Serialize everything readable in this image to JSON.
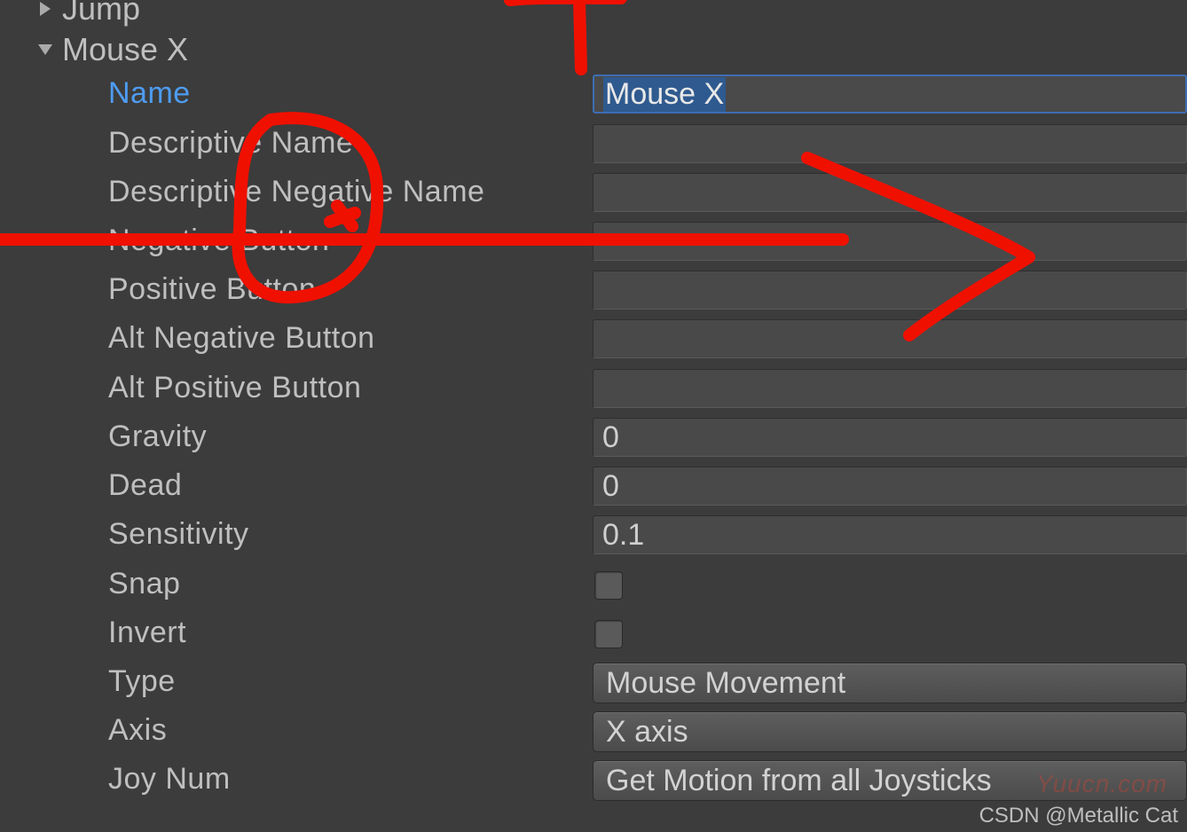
{
  "tree": {
    "jump_label": "Jump",
    "mousex_label": "Mouse X"
  },
  "labels": {
    "name": "Name",
    "descriptive_name": "Descriptive Name",
    "descriptive_negative_name": "Descriptive Negative Name",
    "negative_button": "Negative Button",
    "positive_button": "Positive Button",
    "alt_negative_button": "Alt Negative Button",
    "alt_positive_button": "Alt Positive Button",
    "gravity": "Gravity",
    "dead": "Dead",
    "sensitivity": "Sensitivity",
    "snap": "Snap",
    "invert": "Invert",
    "type": "Type",
    "axis": "Axis",
    "joy_num": "Joy Num"
  },
  "values": {
    "name": "Mouse X",
    "descriptive_name": "",
    "descriptive_negative_name": "",
    "negative_button": "",
    "positive_button": "",
    "alt_negative_button": "",
    "alt_positive_button": "",
    "gravity": "0",
    "dead": "0",
    "sensitivity": "0.1",
    "snap": false,
    "invert": false,
    "type": "Mouse Movement",
    "axis": "X axis",
    "joy_num": "Get Motion from all Joysticks"
  },
  "watermarks": {
    "right": "Yuucn.com",
    "bottom": "CSDN @Metallic Cat"
  }
}
